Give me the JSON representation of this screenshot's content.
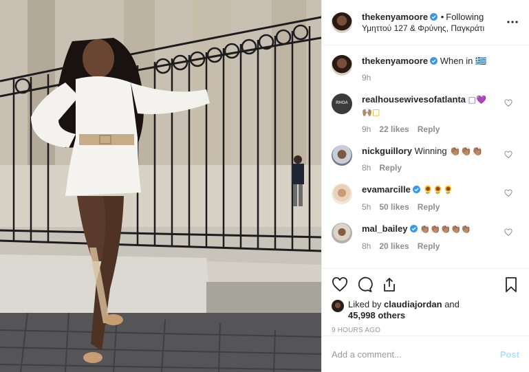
{
  "post": {
    "author": {
      "username": "thekenyamoore",
      "verified": true,
      "follow_status": "Following",
      "location": "Υμηττού 127 & Φρύνης, Παγκράτι"
    },
    "caption": {
      "username": "thekenyamoore",
      "text": "When in 🇬🇷",
      "time": "9h"
    },
    "comments": [
      {
        "username": "realhousewivesofatlanta",
        "avatar_text": "RHOA",
        "text": "□💜",
        "text2": "🙌🏽□",
        "time": "9h",
        "likes": "22 likes",
        "reply": "Reply",
        "verified": false
      },
      {
        "username": "nickguillory",
        "text": "Winning 👏🏽👏🏽👏🏽",
        "time": "8h",
        "likes": "",
        "reply": "Reply",
        "verified": false
      },
      {
        "username": "evamarcille",
        "text": "🌻🌻🌻",
        "time": "5h",
        "likes": "50 likes",
        "reply": "Reply",
        "verified": true
      },
      {
        "username": "mal_bailey",
        "text": "👏🏽👏🏽👏🏽👏🏽👏🏽",
        "time": "8h",
        "likes": "20 likes",
        "reply": "Reply",
        "verified": true
      }
    ],
    "likes": {
      "prefix": "Liked by",
      "liker": "claudiajordan",
      "and": "and",
      "others": "45,998 others"
    },
    "timestamp": "9 HOURS AGO",
    "add_comment": {
      "placeholder": "Add a comment...",
      "post_label": "Post"
    }
  },
  "icons": {
    "more": "more-options-icon",
    "like": "heart-icon",
    "comment": "comment-icon",
    "share": "share-icon",
    "save": "bookmark-icon",
    "verified": "verified-badge-icon"
  },
  "colors": {
    "verified_blue": "#3897f0",
    "post_button_disabled": "#b2dffc",
    "muted_text": "#8e8e8e",
    "text": "#262626"
  }
}
